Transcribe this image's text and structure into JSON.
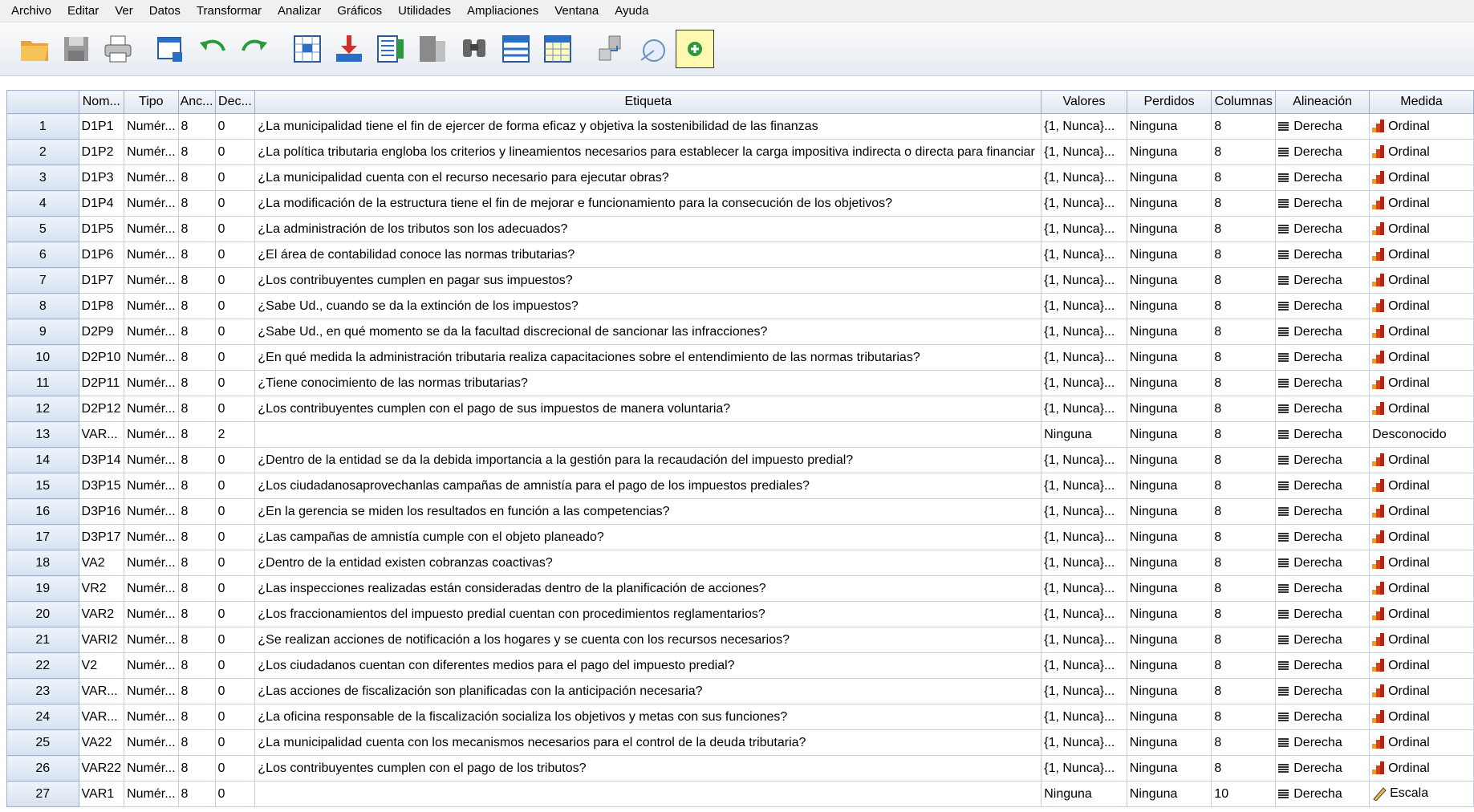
{
  "menu": [
    "Archivo",
    "Editar",
    "Ver",
    "Datos",
    "Transformar",
    "Analizar",
    "Gráficos",
    "Utilidades",
    "Ampliaciones",
    "Ventana",
    "Ayuda"
  ],
  "toolbar_icons": [
    "open-icon",
    "save-icon",
    "print-icon",
    "dialog-recall-icon",
    "undo-icon",
    "redo-icon",
    "goto-case-icon",
    "goto-variable-icon",
    "variables-icon",
    "run-descriptives-icon",
    "find-icon",
    "insert-cases-icon",
    "insert-variable-icon",
    "split-file-icon",
    "select-cases-icon",
    "value-labels-icon"
  ],
  "columns": [
    "",
    "Nom...",
    "Tipo",
    "Anc...",
    "Dec...",
    "Etiqueta",
    "Valores",
    "Perdidos",
    "Columnas",
    "Alineación",
    "Medida"
  ],
  "rows": [
    {
      "n": "1",
      "name": "D1P1",
      "type": "Numér...",
      "width": "8",
      "dec": "0",
      "label": "¿La municipalidad tiene el fin de ejercer de forma eficaz y objetiva la sostenibilidad de las finanzas",
      "values": "{1, Nunca}...",
      "missing": "Ninguna",
      "cols": "8",
      "align": "Derecha",
      "measure": "Ordinal",
      "mtype": "ord"
    },
    {
      "n": "2",
      "name": "D1P2",
      "type": "Numér...",
      "width": "8",
      "dec": "0",
      "label": "¿La política tributaria engloba los criterios y lineamientos necesarios para establecer la carga impositiva indirecta o directa para financiar",
      "values": "{1, Nunca}...",
      "missing": "Ninguna",
      "cols": "8",
      "align": "Derecha",
      "measure": "Ordinal",
      "mtype": "ord"
    },
    {
      "n": "3",
      "name": "D1P3",
      "type": "Numér...",
      "width": "8",
      "dec": "0",
      "label": "¿La municipalidad cuenta con el recurso necesario para ejecutar obras?",
      "values": "{1, Nunca}...",
      "missing": "Ninguna",
      "cols": "8",
      "align": "Derecha",
      "measure": "Ordinal",
      "mtype": "ord"
    },
    {
      "n": "4",
      "name": "D1P4",
      "type": "Numér...",
      "width": "8",
      "dec": "0",
      "label": "¿La modificación de la estructura tiene el fin de mejorar e funcionamiento para la consecución de los objetivos?",
      "values": "{1, Nunca}...",
      "missing": "Ninguna",
      "cols": "8",
      "align": "Derecha",
      "measure": "Ordinal",
      "mtype": "ord"
    },
    {
      "n": "5",
      "name": "D1P5",
      "type": "Numér...",
      "width": "8",
      "dec": "0",
      "label": "¿La administración de los tributos son los adecuados?",
      "values": "{1, Nunca}...",
      "missing": "Ninguna",
      "cols": "8",
      "align": "Derecha",
      "measure": "Ordinal",
      "mtype": "ord"
    },
    {
      "n": "6",
      "name": "D1P6",
      "type": "Numér...",
      "width": "8",
      "dec": "0",
      "label": "¿El área de contabilidad conoce las normas tributarias?",
      "values": "{1, Nunca}...",
      "missing": "Ninguna",
      "cols": "8",
      "align": "Derecha",
      "measure": "Ordinal",
      "mtype": "ord"
    },
    {
      "n": "7",
      "name": "D1P7",
      "type": "Numér...",
      "width": "8",
      "dec": "0",
      "label": "¿Los contribuyentes cumplen en pagar sus impuestos?",
      "values": "{1, Nunca}...",
      "missing": "Ninguna",
      "cols": "8",
      "align": "Derecha",
      "measure": "Ordinal",
      "mtype": "ord"
    },
    {
      "n": "8",
      "name": "D1P8",
      "type": "Numér...",
      "width": "8",
      "dec": "0",
      "label": "¿Sabe Ud., cuando se da la extinción de los impuestos?",
      "values": "{1, Nunca}...",
      "missing": "Ninguna",
      "cols": "8",
      "align": "Derecha",
      "measure": "Ordinal",
      "mtype": "ord"
    },
    {
      "n": "9",
      "name": "D2P9",
      "type": "Numér...",
      "width": "8",
      "dec": "0",
      "label": "¿Sabe Ud., en qué momento se da la facultad discrecional de sancionar las infracciones?",
      "values": "{1, Nunca}...",
      "missing": "Ninguna",
      "cols": "8",
      "align": "Derecha",
      "measure": "Ordinal",
      "mtype": "ord"
    },
    {
      "n": "10",
      "name": "D2P10",
      "type": "Numér...",
      "width": "8",
      "dec": "0",
      "label": "¿En qué medida la administración tributaria realiza capacitaciones sobre el entendimiento de las normas tributarias?",
      "values": "{1, Nunca}...",
      "missing": "Ninguna",
      "cols": "8",
      "align": "Derecha",
      "measure": "Ordinal",
      "mtype": "ord"
    },
    {
      "n": "11",
      "name": "D2P11",
      "type": "Numér...",
      "width": "8",
      "dec": "0",
      "label": "¿Tiene conocimiento de las normas tributarias?",
      "values": "{1, Nunca}...",
      "missing": "Ninguna",
      "cols": "8",
      "align": "Derecha",
      "measure": "Ordinal",
      "mtype": "ord"
    },
    {
      "n": "12",
      "name": "D2P12",
      "type": "Numér...",
      "width": "8",
      "dec": "0",
      "label": "¿Los contribuyentes cumplen con el pago de sus impuestos de manera voluntaria?",
      "values": "{1, Nunca}...",
      "missing": "Ninguna",
      "cols": "8",
      "align": "Derecha",
      "measure": "Ordinal",
      "mtype": "ord"
    },
    {
      "n": "13",
      "name": "VAR...",
      "type": "Numér...",
      "width": "8",
      "dec": "2",
      "label": "",
      "values": "Ninguna",
      "missing": "Ninguna",
      "cols": "8",
      "align": "Derecha",
      "measure": "Desconocido",
      "mtype": "none"
    },
    {
      "n": "14",
      "name": "D3P14",
      "type": "Numér...",
      "width": "8",
      "dec": "0",
      "label": "¿Dentro de la entidad se da la debida importancia a  la gestión para la recaudación del impuesto predial?",
      "values": "{1, Nunca}...",
      "missing": "Ninguna",
      "cols": "8",
      "align": "Derecha",
      "measure": "Ordinal",
      "mtype": "ord"
    },
    {
      "n": "15",
      "name": "D3P15",
      "type": "Numér...",
      "width": "8",
      "dec": "0",
      "label": "¿Los ciudadanosaprovechanlas campañas de amnistía para el pago de los impuestos prediales?",
      "values": "{1, Nunca}...",
      "missing": "Ninguna",
      "cols": "8",
      "align": "Derecha",
      "measure": "Ordinal",
      "mtype": "ord"
    },
    {
      "n": "16",
      "name": "D3P16",
      "type": "Numér...",
      "width": "8",
      "dec": "0",
      "label": "¿En la gerencia se miden los resultados en función a las competencias?",
      "values": "{1, Nunca}...",
      "missing": "Ninguna",
      "cols": "8",
      "align": "Derecha",
      "measure": "Ordinal",
      "mtype": "ord"
    },
    {
      "n": "17",
      "name": "D3P17",
      "type": "Numér...",
      "width": "8",
      "dec": "0",
      "label": "¿Las campañas de amnistía cumple con el objeto planeado?",
      "values": "{1, Nunca}...",
      "missing": "Ninguna",
      "cols": "8",
      "align": "Derecha",
      "measure": "Ordinal",
      "mtype": "ord"
    },
    {
      "n": "18",
      "name": "VA2",
      "type": "Numér...",
      "width": "8",
      "dec": "0",
      "label": "¿Dentro de la entidad existen cobranzas coactivas?",
      "values": "{1, Nunca}...",
      "missing": "Ninguna",
      "cols": "8",
      "align": "Derecha",
      "measure": "Ordinal",
      "mtype": "ord"
    },
    {
      "n": "19",
      "name": "VR2",
      "type": "Numér...",
      "width": "8",
      "dec": "0",
      "label": "¿Las inspecciones   realizadas   están consideradas dentro de la planificación de acciones?",
      "values": "{1, Nunca}...",
      "missing": "Ninguna",
      "cols": "8",
      "align": "Derecha",
      "measure": "Ordinal",
      "mtype": "ord"
    },
    {
      "n": "20",
      "name": "VAR2",
      "type": "Numér...",
      "width": "8",
      "dec": "0",
      "label": "¿Los fraccionamientos del impuesto predial cuentan con procedimientos reglamentarios?",
      "values": "{1, Nunca}...",
      "missing": "Ninguna",
      "cols": "8",
      "align": "Derecha",
      "measure": "Ordinal",
      "mtype": "ord"
    },
    {
      "n": "21",
      "name": "VARI2",
      "type": "Numér...",
      "width": "8",
      "dec": "0",
      "label": "¿Se realizan acciones de notificación a los hogares y se cuenta con los recursos necesarios?",
      "values": "{1, Nunca}...",
      "missing": "Ninguna",
      "cols": "8",
      "align": "Derecha",
      "measure": "Ordinal",
      "mtype": "ord"
    },
    {
      "n": "22",
      "name": "V2",
      "type": "Numér...",
      "width": "8",
      "dec": "0",
      "label": "¿Los ciudadanos cuentan con diferentes medios para el pago del impuesto predial?",
      "values": "{1, Nunca}...",
      "missing": "Ninguna",
      "cols": "8",
      "align": "Derecha",
      "measure": "Ordinal",
      "mtype": "ord"
    },
    {
      "n": "23",
      "name": "VAR...",
      "type": "Numér...",
      "width": "8",
      "dec": "0",
      "label": "¿Las acciones de fiscalización son planificadas con la anticipación necesaria?",
      "values": "{1, Nunca}...",
      "missing": "Ninguna",
      "cols": "8",
      "align": "Derecha",
      "measure": "Ordinal",
      "mtype": "ord"
    },
    {
      "n": "24",
      "name": "VAR...",
      "type": "Numér...",
      "width": "8",
      "dec": "0",
      "label": "¿La oficina responsable de la fiscalización socializa los objetivos y metas con sus funciones?",
      "values": "{1, Nunca}...",
      "missing": "Ninguna",
      "cols": "8",
      "align": "Derecha",
      "measure": "Ordinal",
      "mtype": "ord"
    },
    {
      "n": "25",
      "name": "VA22",
      "type": "Numér...",
      "width": "8",
      "dec": "0",
      "label": "¿La municipalidad cuenta con los mecanismos necesarios para el control de la deuda tributaria?",
      "values": "{1, Nunca}...",
      "missing": "Ninguna",
      "cols": "8",
      "align": "Derecha",
      "measure": "Ordinal",
      "mtype": "ord"
    },
    {
      "n": "26",
      "name": "VAR22",
      "type": "Numér...",
      "width": "8",
      "dec": "0",
      "label": "¿Los contribuyentes cumplen con el pago de los tributos?",
      "values": "{1, Nunca}...",
      "missing": "Ninguna",
      "cols": "8",
      "align": "Derecha",
      "measure": "Ordinal",
      "mtype": "ord"
    },
    {
      "n": "27",
      "name": "VAR1",
      "type": "Numér...",
      "width": "8",
      "dec": "0",
      "label": "",
      "values": "Ninguna",
      "missing": "Ninguna",
      "cols": "10",
      "align": "Derecha",
      "measure": "Escala",
      "mtype": "scale"
    }
  ]
}
